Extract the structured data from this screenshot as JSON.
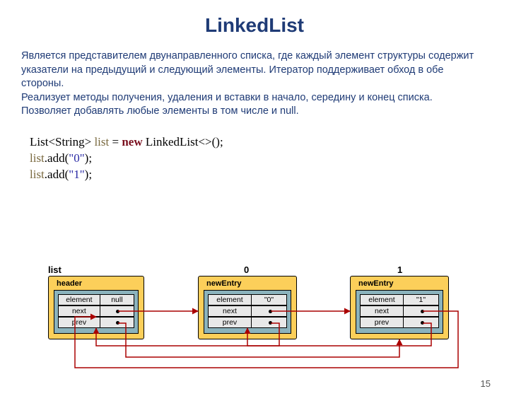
{
  "title": "LinkedList",
  "desc": {
    "p1": "Является представителем двунаправленного списка, где каждый элемент структуры содержит указатели на предыдущий и следующий элементы. Итератор поддерживает обход в обе стороны.",
    "p2": "Реализует методы получения, удаления и вставки в начало, середину и конец списка.",
    "p3": "Позволяет добавлять любые элементы в том числе и null."
  },
  "code": {
    "line1_a": "List<String>",
    "line1_b": "list",
    "line1_c": " = ",
    "line1_d": "new",
    "line1_e": " LinkedList<>();",
    "line2_a": "list",
    "line2_b": ".add(",
    "line2_c": "\"0\"",
    "line2_d": ");",
    "line3_a": "list",
    "line3_b": ".add(",
    "line3_c": "\"1\"",
    "line3_d": ");"
  },
  "diagram": {
    "nodes": [
      {
        "top_label": "list",
        "inner_title": "header",
        "rows": [
          {
            "l": "element",
            "r": "null"
          },
          {
            "l": "next",
            "r": ""
          },
          {
            "l": "prev",
            "r": ""
          }
        ]
      },
      {
        "top_label": "0",
        "inner_title": "newEntry",
        "rows": [
          {
            "l": "element",
            "r": "\"0\""
          },
          {
            "l": "next",
            "r": ""
          },
          {
            "l": "prev",
            "r": ""
          }
        ]
      },
      {
        "top_label": "1",
        "inner_title": "newEntry",
        "rows": [
          {
            "l": "element",
            "r": "\"1\""
          },
          {
            "l": "next",
            "r": ""
          },
          {
            "l": "prev",
            "r": ""
          }
        ]
      }
    ]
  },
  "slide_number": "15"
}
